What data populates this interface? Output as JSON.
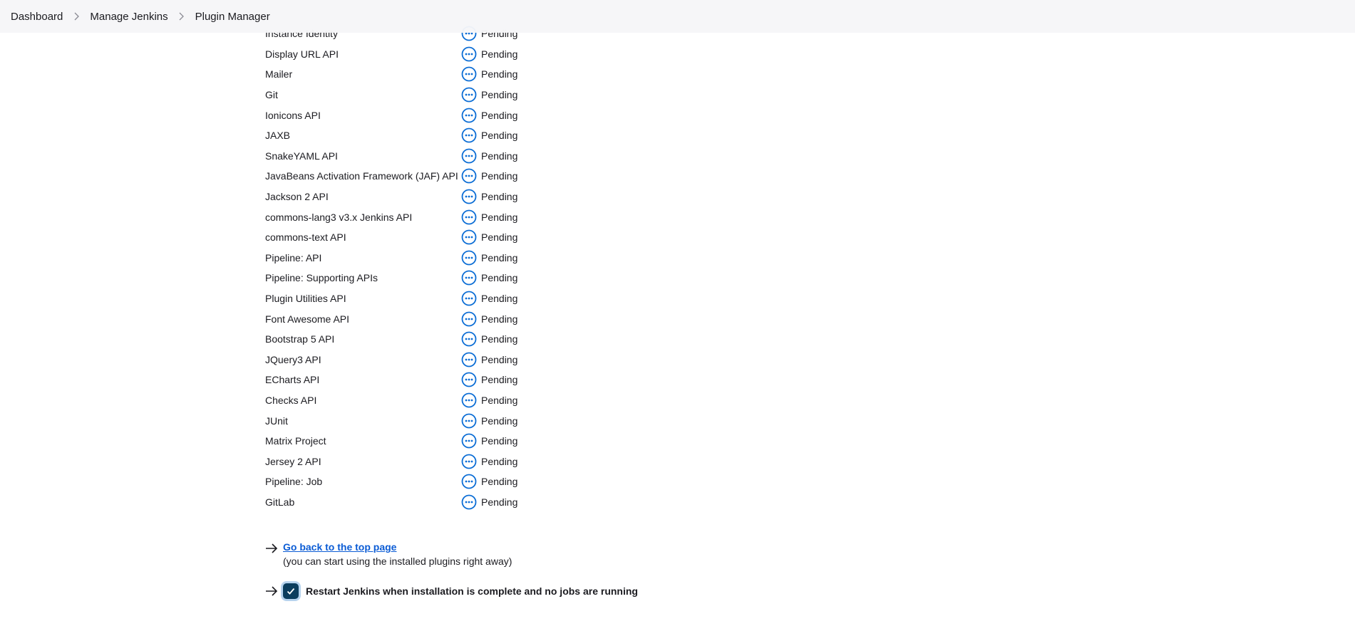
{
  "breadcrumb": {
    "items": [
      "Dashboard",
      "Manage Jenkins",
      "Plugin Manager"
    ]
  },
  "plugins": [
    {
      "name": "Instance Identity",
      "status": "Pending"
    },
    {
      "name": "Display URL API",
      "status": "Pending"
    },
    {
      "name": "Mailer",
      "status": "Pending"
    },
    {
      "name": "Git",
      "status": "Pending"
    },
    {
      "name": "Ionicons API",
      "status": "Pending"
    },
    {
      "name": "JAXB",
      "status": "Pending"
    },
    {
      "name": "SnakeYAML API",
      "status": "Pending"
    },
    {
      "name": "JavaBeans Activation Framework (JAF) API",
      "status": "Pending"
    },
    {
      "name": "Jackson 2 API",
      "status": "Pending"
    },
    {
      "name": "commons-lang3 v3.x Jenkins API",
      "status": "Pending"
    },
    {
      "name": "commons-text API",
      "status": "Pending"
    },
    {
      "name": "Pipeline: API",
      "status": "Pending"
    },
    {
      "name": "Pipeline: Supporting APIs",
      "status": "Pending"
    },
    {
      "name": "Plugin Utilities API",
      "status": "Pending"
    },
    {
      "name": "Font Awesome API",
      "status": "Pending"
    },
    {
      "name": "Bootstrap 5 API",
      "status": "Pending"
    },
    {
      "name": "JQuery3 API",
      "status": "Pending"
    },
    {
      "name": "ECharts API",
      "status": "Pending"
    },
    {
      "name": "Checks API",
      "status": "Pending"
    },
    {
      "name": "JUnit",
      "status": "Pending"
    },
    {
      "name": "Matrix Project",
      "status": "Pending"
    },
    {
      "name": "Jersey 2 API",
      "status": "Pending"
    },
    {
      "name": "Pipeline: Job",
      "status": "Pending"
    },
    {
      "name": "GitLab",
      "status": "Pending"
    }
  ],
  "footer": {
    "go_back_link": "Go back to the top page",
    "go_back_note": "(you can start using the installed plugins right away)",
    "restart_label": "Restart Jenkins when installation is complete and no jobs are running",
    "restart_checked": true
  },
  "colors": {
    "link": "#0b5cd5",
    "pending_icon": "#0b6dd5",
    "checkbox_fill": "#0b3d5e",
    "header_bg": "#f6f6f8"
  },
  "icons": {
    "breadcrumb_separator": "chevron-right-icon",
    "pending": "ellipsis-circle-icon",
    "arrow": "arrow-right-icon",
    "checkbox": "checkmark-icon"
  }
}
